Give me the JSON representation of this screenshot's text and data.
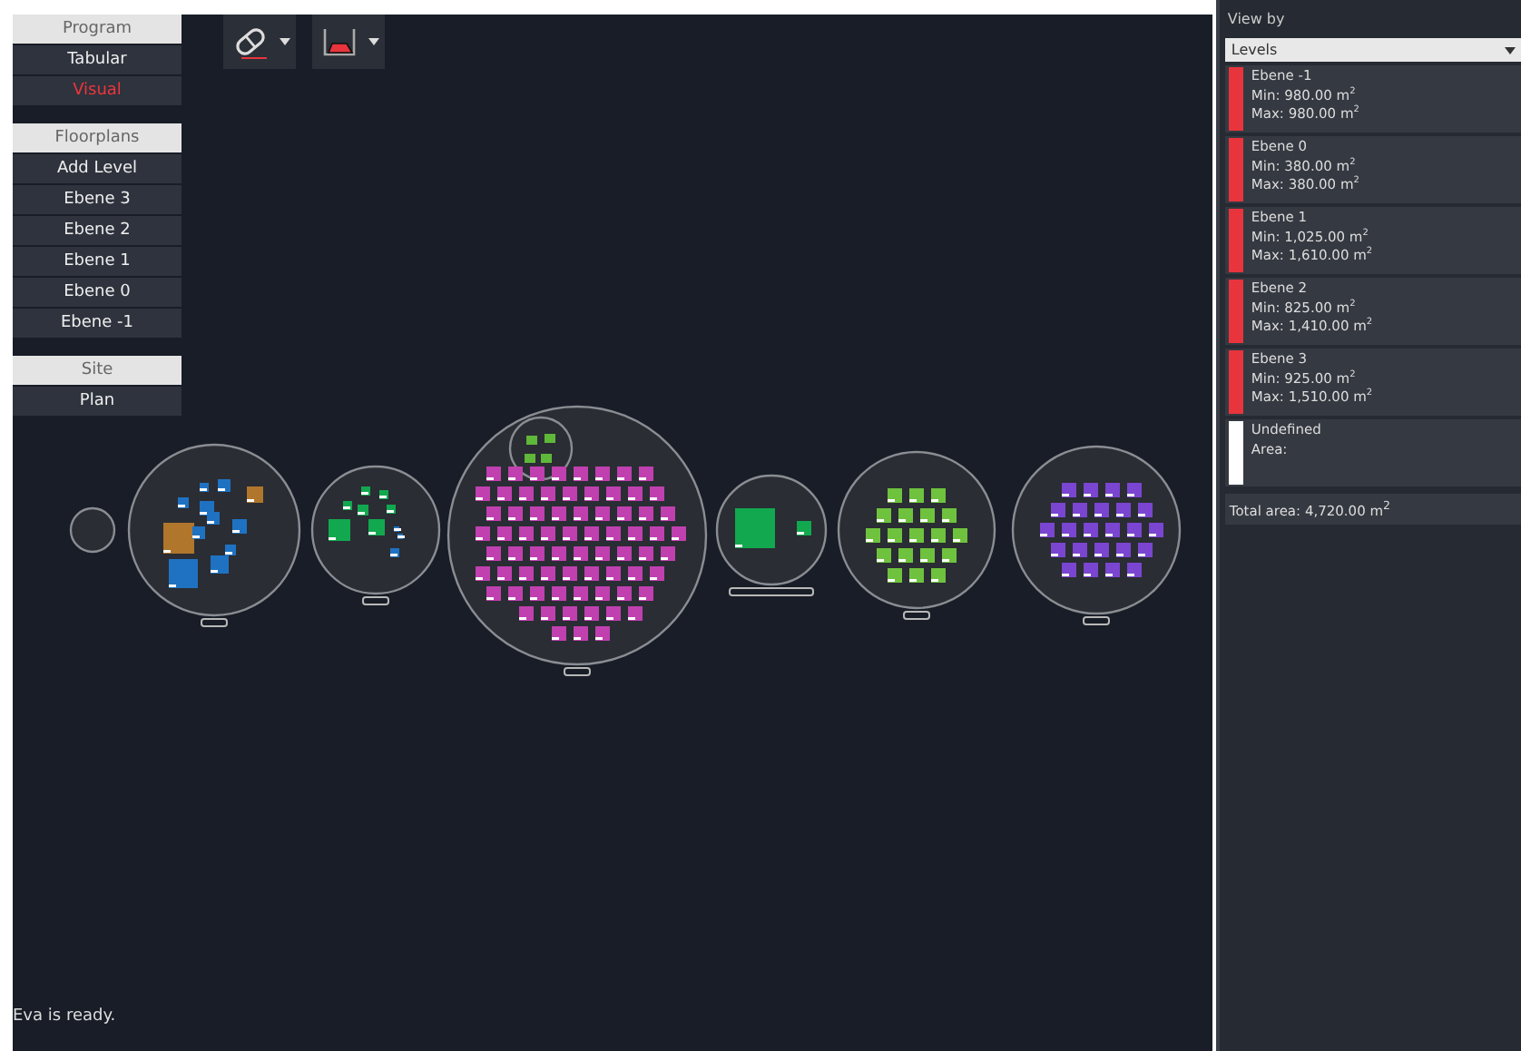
{
  "sidebar": {
    "sections": [
      {
        "header": "Program",
        "items": [
          {
            "label": "Tabular",
            "selected": false
          },
          {
            "label": "Visual",
            "selected": true
          }
        ]
      },
      {
        "header": "Floorplans",
        "items": [
          {
            "label": "Add Level",
            "selected": false
          },
          {
            "label": "Ebene 3",
            "selected": false
          },
          {
            "label": "Ebene 2",
            "selected": false
          },
          {
            "label": "Ebene 1",
            "selected": false
          },
          {
            "label": "Ebene 0",
            "selected": false
          },
          {
            "label": "Ebene -1",
            "selected": false
          }
        ]
      },
      {
        "header": "Site",
        "items": [
          {
            "label": "Plan",
            "selected": false
          }
        ]
      }
    ]
  },
  "toolbar": [
    {
      "kind": "eraser"
    },
    {
      "kind": "floorplan"
    }
  ],
  "status": "Eva is ready.",
  "panel": {
    "label": "View by",
    "select": "Levels",
    "levels": [
      {
        "name": "Ebene -1",
        "min": "Min: 980.00 m$^{2}$",
        "max": "Max: 980.00 m$^{2}$",
        "color": "#e8343c"
      },
      {
        "name": "Ebene 0",
        "min": "Min: 380.00 m$^{2}$",
        "max": "Max: 380.00 m$^{2}$",
        "color": "#e8343c"
      },
      {
        "name": "Ebene 1",
        "min": "Min: 1,025.00 m$^{2}$",
        "max": "Max: 1,610.00 m$^{2}$",
        "color": "#e8343c"
      },
      {
        "name": "Ebene 2",
        "min": "Min: 825.00 m$^{2}$",
        "max": "Max: 1,410.00 m$^{2}$",
        "color": "#e8343c"
      },
      {
        "name": "Ebene 3",
        "min": "Min: 925.00 m$^{2}$",
        "max": "Max: 1,510.00 m$^{2}$",
        "color": "#e8343c"
      },
      {
        "name": "Undefined",
        "min": "Area:",
        "color": "#ffffff"
      }
    ],
    "total": "Total area: 4,720.00 m$^{2}$"
  }
}
